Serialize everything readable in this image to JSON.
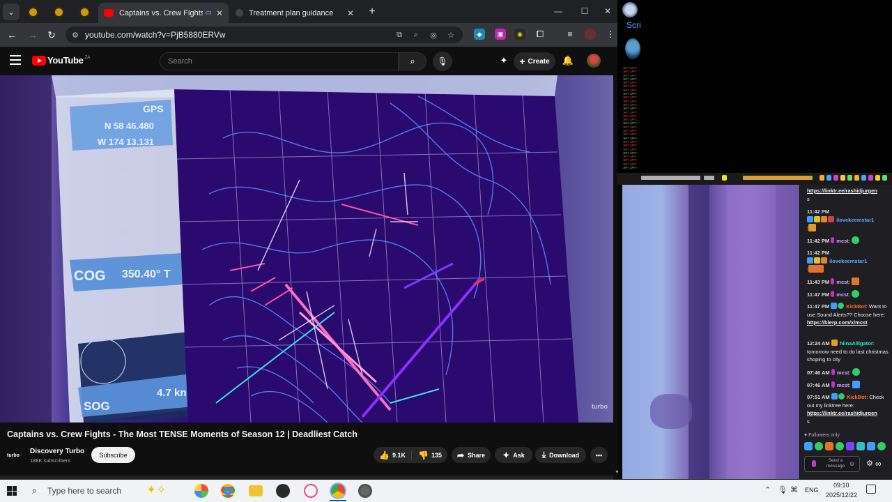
{
  "browser": {
    "tabs": [
      {
        "label": "Captains vs. Crew Fights - T",
        "active": true
      },
      {
        "label": "Treatment plan guidance",
        "active": false
      }
    ],
    "url": "youtube.com/watch?v=PjB5880ERVw"
  },
  "youtube": {
    "logo_text": "YouTube",
    "country_code": "ZA",
    "search_placeholder": "Search",
    "create_label": "Create",
    "video": {
      "title": "Captains vs. Crew Fights - The Most TENSE Moments of Season 12 | Deadliest Catch",
      "watermark": "turbo"
    },
    "channel": {
      "avatar_text": "turbo",
      "name": "Discovery Turbo",
      "subscribers": "188K subscribers",
      "subscribe_label": "Subscribe"
    },
    "actions": {
      "likes": "9.1K",
      "dislikes": "135",
      "share": "Share",
      "ask": "Ask",
      "download": "Download"
    }
  },
  "side_panel": {
    "label": "Scri"
  },
  "chat": {
    "messages": [
      {
        "link": "https://linktr.ee/rashidjurgen",
        "tail": "s"
      },
      {
        "time": "11:42 PM",
        "user": "ilovekeemstar1",
        "user_color": "#5ca8ff"
      },
      {
        "time": "11:42 PM",
        "user": "mcst",
        "user_color": "#d6a4ff"
      },
      {
        "time": "11:42 PM",
        "user": "ilovekeemstar1",
        "user_color": "#5ca8ff"
      },
      {
        "time": "11:43 PM",
        "user": "mcst",
        "user_color": "#d6a4ff"
      },
      {
        "time": "11:47 PM",
        "user": "mcst",
        "user_color": "#d6a4ff"
      },
      {
        "time": "11:47 PM",
        "user": "KickBot",
        "user_color": "#ff6a2a",
        "text": "Want to use Sound Alerts?? Choose here:",
        "link": "https://blerp.com/x/mcst"
      },
      {
        "time": "12:24 AM",
        "user": "hiinaAlligator",
        "user_color": "#2ee8c6",
        "text": "tomorrow need to do last christmas shoping to city"
      },
      {
        "time": "07:46 AM",
        "user": "mcst",
        "user_color": "#d6a4ff"
      },
      {
        "time": "07:46 AM",
        "user": "mcst",
        "user_color": "#d6a4ff"
      },
      {
        "time": "07:51 AM",
        "user": "KickBot",
        "user_color": "#ff6a2a",
        "text": "Check out my linktree here:",
        "link": "https://linktr.ee/rashidjurgen",
        "tail": "s"
      }
    ],
    "followers_only": "Followers only",
    "input_placeholder": "Send a message"
  },
  "taskbar": {
    "search_placeholder": "Type here to search",
    "language": "ENG",
    "time": "09:10",
    "date": "2025/12/22"
  },
  "colors": {
    "youtube_red": "#ff0000",
    "chat_bg": "#1f1f23",
    "taskbar_bg": "#f0f2f5"
  }
}
